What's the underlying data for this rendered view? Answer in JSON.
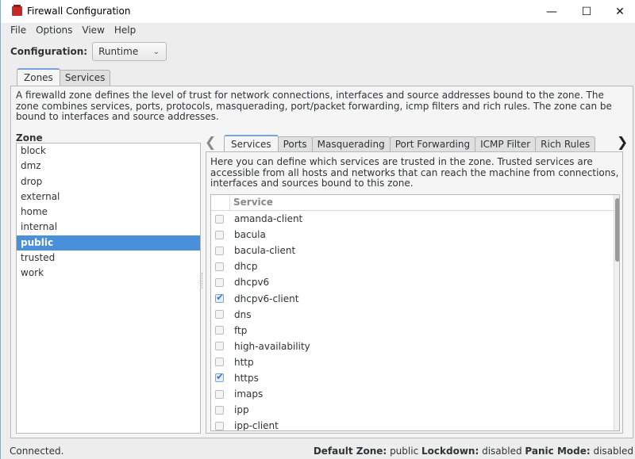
{
  "window": {
    "title": "Firewall Configuration",
    "controls": {
      "minimize": "—",
      "maximize": "☐",
      "close": "✕"
    }
  },
  "menu": [
    "File",
    "Options",
    "View",
    "Help"
  ],
  "configuration": {
    "label": "Configuration:",
    "value": "Runtime"
  },
  "top_tabs": [
    {
      "label": "Zones",
      "active": true
    },
    {
      "label": "Services",
      "active": false
    }
  ],
  "zones": {
    "description": "A firewalld zone defines the level of trust for network connections, interfaces and source addresses bound to the zone. The zone combines services, ports, protocols, masquerading, port/packet forwarding, icmp filters and rich rules. The zone can be bound to interfaces and source addresses.",
    "list_label": "Zone",
    "items": [
      "block",
      "dmz",
      "drop",
      "external",
      "home",
      "internal",
      "public",
      "trusted",
      "work"
    ],
    "selected": "public"
  },
  "sub_tabs": [
    {
      "label": "Services",
      "active": true
    },
    {
      "label": "Ports",
      "active": false
    },
    {
      "label": "Masquerading",
      "active": false
    },
    {
      "label": "Port Forwarding",
      "active": false
    },
    {
      "label": "ICMP Filter",
      "active": false
    },
    {
      "label": "Rich Rules",
      "active": false
    }
  ],
  "services": {
    "description": "Here you can define which services are trusted in the zone. Trusted services are accessible from all hosts and networks that can reach the machine from connections, interfaces and sources bound to this zone.",
    "column_header": "Service",
    "rows": [
      {
        "name": "amanda-client",
        "checked": false
      },
      {
        "name": "bacula",
        "checked": false
      },
      {
        "name": "bacula-client",
        "checked": false
      },
      {
        "name": "dhcp",
        "checked": false
      },
      {
        "name": "dhcpv6",
        "checked": false
      },
      {
        "name": "dhcpv6-client",
        "checked": true
      },
      {
        "name": "dns",
        "checked": false
      },
      {
        "name": "ftp",
        "checked": false
      },
      {
        "name": "high-availability",
        "checked": false
      },
      {
        "name": "http",
        "checked": false
      },
      {
        "name": "https",
        "checked": true
      },
      {
        "name": "imaps",
        "checked": false
      },
      {
        "name": "ipp",
        "checked": false
      },
      {
        "name": "ipp-client",
        "checked": false
      }
    ]
  },
  "status": {
    "left": "Connected.",
    "default_zone_label": "Default Zone:",
    "default_zone_value": "public",
    "lockdown_label": "Lockdown:",
    "lockdown_value": "disabled",
    "panic_label": "Panic Mode:",
    "panic_value": "disabled"
  },
  "colors": {
    "selection": "#4a90d9",
    "tab_accent": "#7aa3d8",
    "app_icon": "#c62828"
  }
}
